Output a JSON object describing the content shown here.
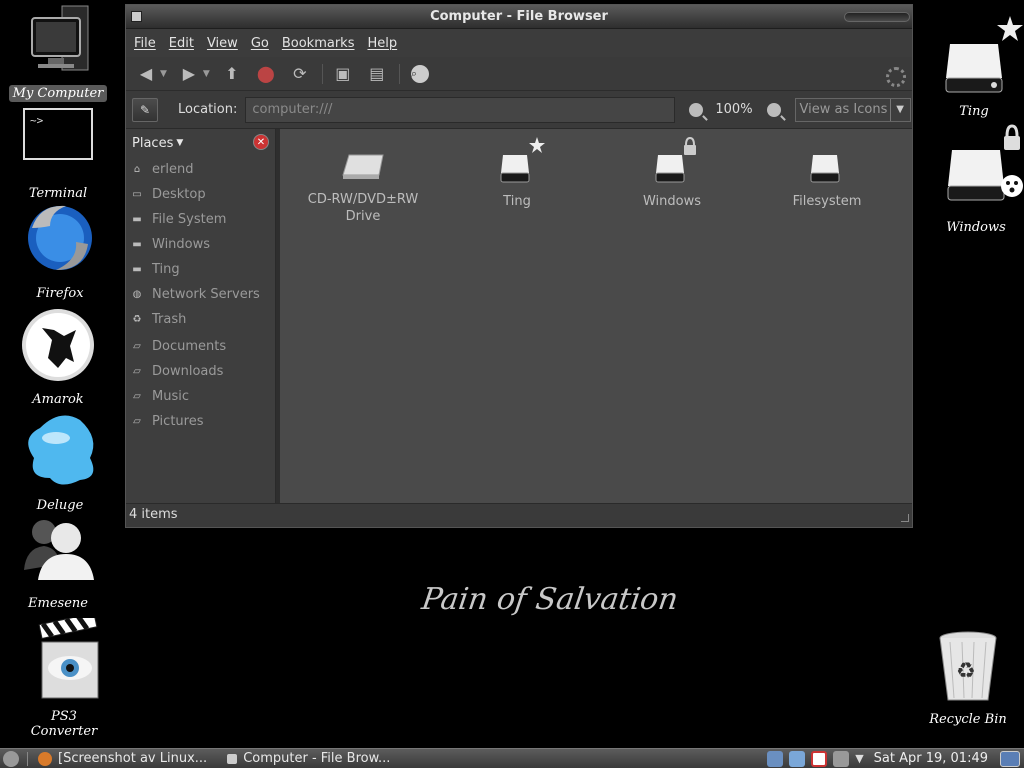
{
  "desktop": {
    "icons_left": [
      {
        "label": "My Computer",
        "icon": "computer-icon"
      },
      {
        "label": "Terminal",
        "icon": "terminal-icon"
      },
      {
        "label": "Firefox",
        "icon": "firefox-icon"
      },
      {
        "label": "Amarok",
        "icon": "amarok-icon"
      },
      {
        "label": "Deluge",
        "icon": "deluge-icon"
      },
      {
        "label": "Emesene",
        "icon": "emesene-icon"
      },
      {
        "label": "PS3 Converter",
        "icon": "clapperboard-icon"
      }
    ],
    "icons_right": [
      {
        "label": "Ting",
        "icon": "drive-icon"
      },
      {
        "label": "Windows",
        "icon": "drive-icon"
      },
      {
        "label": "Recycle Bin",
        "icon": "trash-icon"
      }
    ],
    "wallpaper_text": "Pain of Salvation"
  },
  "window": {
    "title": "Computer - File Browser",
    "menu": [
      "File",
      "Edit",
      "View",
      "Go",
      "Bookmarks",
      "Help"
    ],
    "location_label": "Location:",
    "location_value": "computer:///",
    "zoom": "100%",
    "view_mode": "View as Icons",
    "sidebar": {
      "header": "Places",
      "items": [
        {
          "label": "erlend",
          "icon": "home-icon"
        },
        {
          "label": "Desktop",
          "icon": "desktop-icon"
        },
        {
          "label": "File System",
          "icon": "drive-icon"
        },
        {
          "label": "Windows",
          "icon": "drive-icon"
        },
        {
          "label": "Ting",
          "icon": "drive-icon"
        },
        {
          "label": "Network Servers",
          "icon": "network-icon"
        },
        {
          "label": "Trash",
          "icon": "trash-icon"
        },
        {
          "label": "Documents",
          "icon": "folder-icon"
        },
        {
          "label": "Downloads",
          "icon": "folder-icon"
        },
        {
          "label": "Music",
          "icon": "folder-icon"
        },
        {
          "label": "Pictures",
          "icon": "folder-icon"
        }
      ]
    },
    "files": [
      {
        "label": "CD-RW/DVD±RW Drive",
        "icon": "optical-drive-icon"
      },
      {
        "label": "Ting",
        "icon": "drive-icon"
      },
      {
        "label": "Windows",
        "icon": "drive-icon"
      },
      {
        "label": "Filesystem",
        "icon": "drive-icon"
      }
    ],
    "status": "4 items"
  },
  "taskbar": {
    "tasks": [
      {
        "label": "[Screenshot av Linux..."
      },
      {
        "label": "Computer - File Brow..."
      }
    ],
    "clock": "Sat Apr 19, 01:49"
  }
}
